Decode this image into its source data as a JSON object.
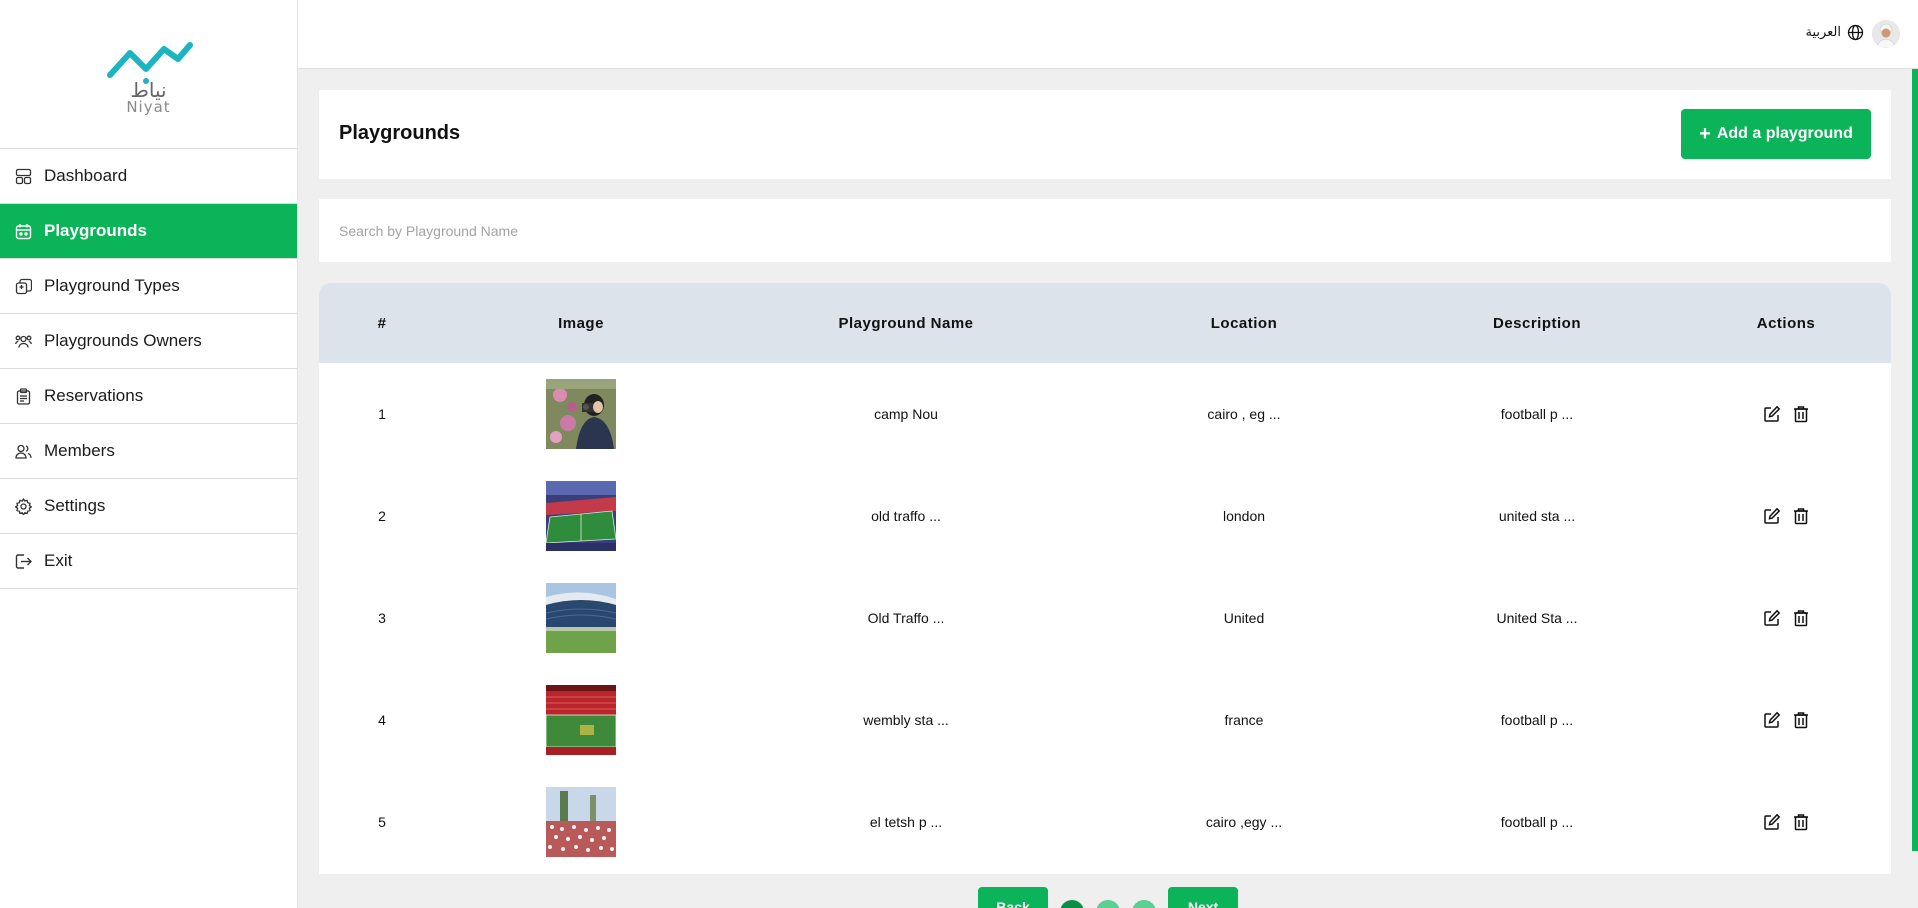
{
  "brand": {
    "arabic": "نياط",
    "latin": "Niyat",
    "color": "#1bb5c0"
  },
  "accent_color": "#0bb458",
  "topbar": {
    "language_label": "العربية",
    "globe_icon": "globe-icon"
  },
  "sidebar": {
    "items": [
      {
        "label": "Dashboard",
        "icon": "dashboard-icon",
        "active": false
      },
      {
        "label": "Playgrounds",
        "icon": "calendar-icon",
        "active": true
      },
      {
        "label": "Playground Types",
        "icon": "layers-icon",
        "active": false
      },
      {
        "label": "Playgrounds Owners",
        "icon": "users-icon",
        "active": false
      },
      {
        "label": "Reservations",
        "icon": "clipboard-icon",
        "active": false
      },
      {
        "label": "Members",
        "icon": "members-icon",
        "active": false
      },
      {
        "label": "Settings",
        "icon": "gear-icon",
        "active": false
      },
      {
        "label": "Exit",
        "icon": "logout-icon",
        "active": false
      }
    ]
  },
  "header": {
    "title": "Playgrounds",
    "add_button": "Add a playground"
  },
  "search": {
    "placeholder": "Search by Playground Name",
    "value": ""
  },
  "table": {
    "columns": [
      "#",
      "Image",
      "Playground Name",
      "Location",
      "Description",
      "Actions"
    ],
    "rows": [
      {
        "num": "1",
        "image": "photographer-with-flowers",
        "name": "camp Nou",
        "location": "cairo , eg ...",
        "description": "football p ..."
      },
      {
        "num": "2",
        "image": "stadium-aerial-blue",
        "name": "old traffo ...",
        "location": "london",
        "description": "united sta ..."
      },
      {
        "num": "3",
        "image": "stadium-stand-sky",
        "name": "Old Traffo ...",
        "location": "United",
        "description": "United Sta ..."
      },
      {
        "num": "4",
        "image": "stadium-red-seats",
        "name": "wembly sta ...",
        "location": "france",
        "description": "football p ..."
      },
      {
        "num": "5",
        "image": "stadium-crowd",
        "name": "el tetsh p ...",
        "location": "cairo ,egy ...",
        "description": "football p ..."
      }
    ]
  },
  "pagination": {
    "prev_label": "Back",
    "next_label": "Next",
    "pages": 3,
    "current": 1
  }
}
